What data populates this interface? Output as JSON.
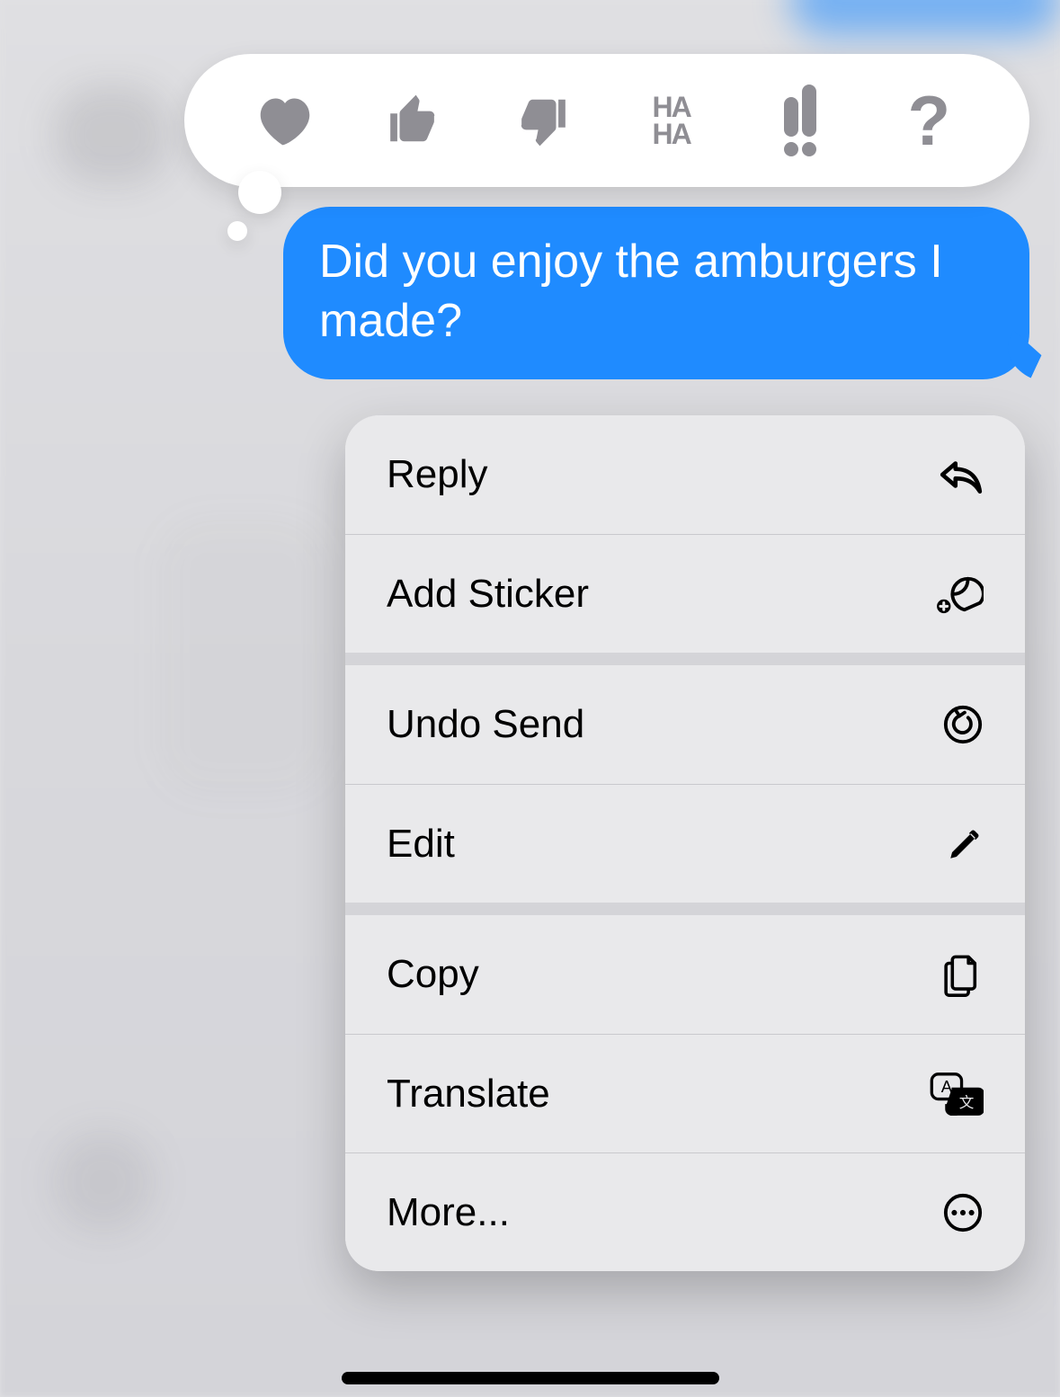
{
  "message": {
    "text": "Did you enjoy the amburgers I made?"
  },
  "tapbacks": {
    "heart": {
      "name": "heart-icon"
    },
    "thumbs_up": {
      "name": "thumbs-up-icon"
    },
    "thumbs_down": {
      "name": "thumbs-down-icon"
    },
    "haha": {
      "name": "haha-icon",
      "line1": "HA",
      "line2": "HA"
    },
    "exclamation": {
      "name": "exclamation-icon"
    },
    "question": {
      "name": "question-icon",
      "glyph": "?"
    }
  },
  "menu_groups": [
    [
      {
        "id": "reply",
        "label": "Reply",
        "icon": "reply-arrow-icon"
      },
      {
        "id": "add-sticker",
        "label": "Add Sticker",
        "icon": "sticker-add-icon"
      }
    ],
    [
      {
        "id": "undo-send",
        "label": "Undo Send",
        "icon": "undo-circle-icon"
      },
      {
        "id": "edit",
        "label": "Edit",
        "icon": "pencil-icon"
      }
    ],
    [
      {
        "id": "copy",
        "label": "Copy",
        "icon": "documents-icon"
      },
      {
        "id": "translate",
        "label": "Translate",
        "icon": "translate-icon"
      },
      {
        "id": "more",
        "label": "More...",
        "icon": "ellipsis-circle-icon"
      }
    ]
  ],
  "colors": {
    "bubble_blue": "#1f8bff",
    "menu_bg": "#e9e9eb",
    "icon_gray": "#8f8e94"
  }
}
